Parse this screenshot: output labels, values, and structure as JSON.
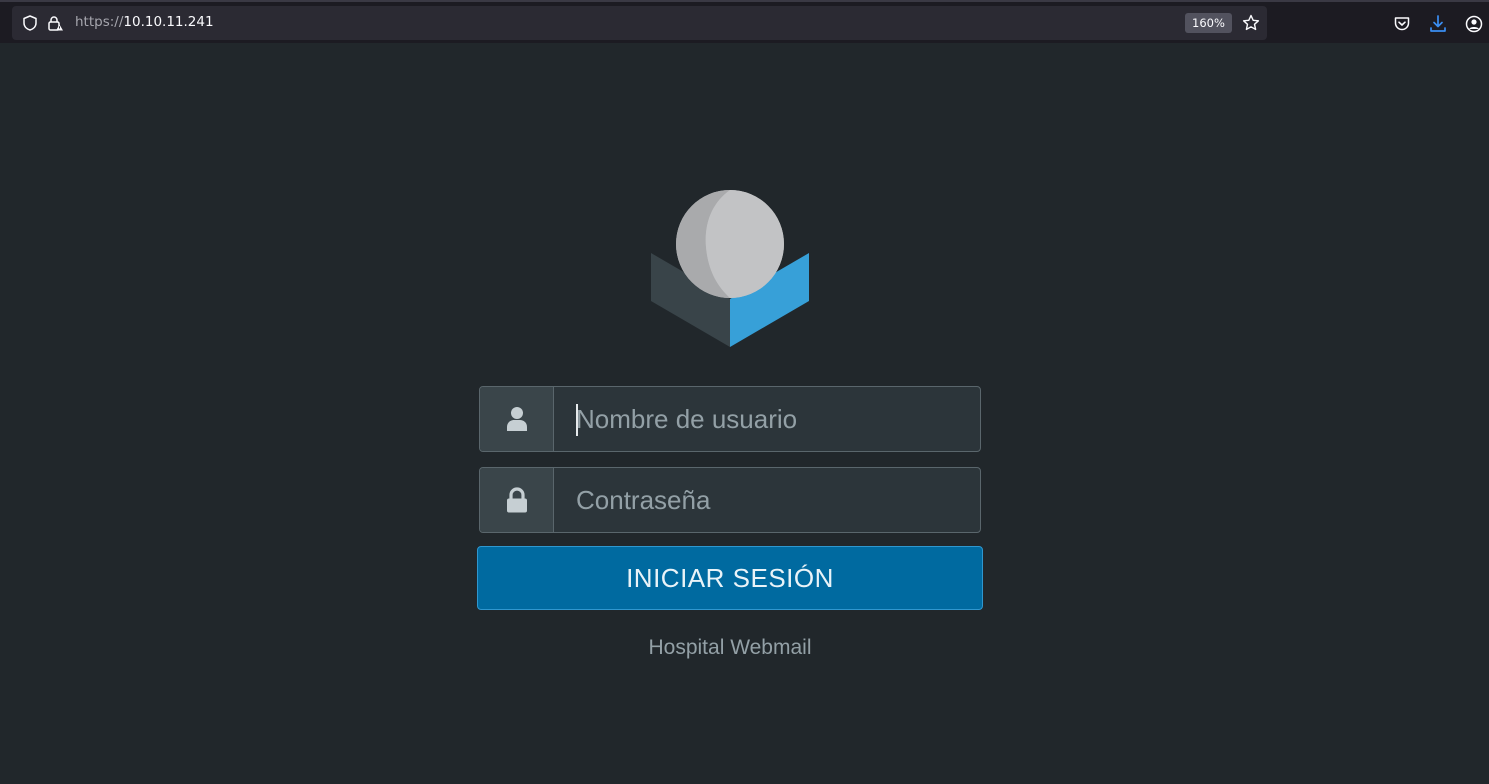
{
  "browser": {
    "url_scheme": "https://",
    "url_host": "10.10.11.241",
    "zoom": "160%",
    "icons": [
      "shield-icon",
      "insecure-lock-icon",
      "bookmark-star-icon",
      "pocket-icon",
      "download-icon",
      "account-icon"
    ]
  },
  "login": {
    "username_placeholder": "Nombre de usuario",
    "password_placeholder": "Contraseña",
    "submit_label": "INICIAR SESIÓN",
    "footer": "Hospital Webmail",
    "icons": [
      "roundcube-logo",
      "user-icon",
      "lock-icon"
    ]
  },
  "colors": {
    "background": "#21272b",
    "accent": "#006aa0",
    "logo_blue": "#37a0d8"
  }
}
